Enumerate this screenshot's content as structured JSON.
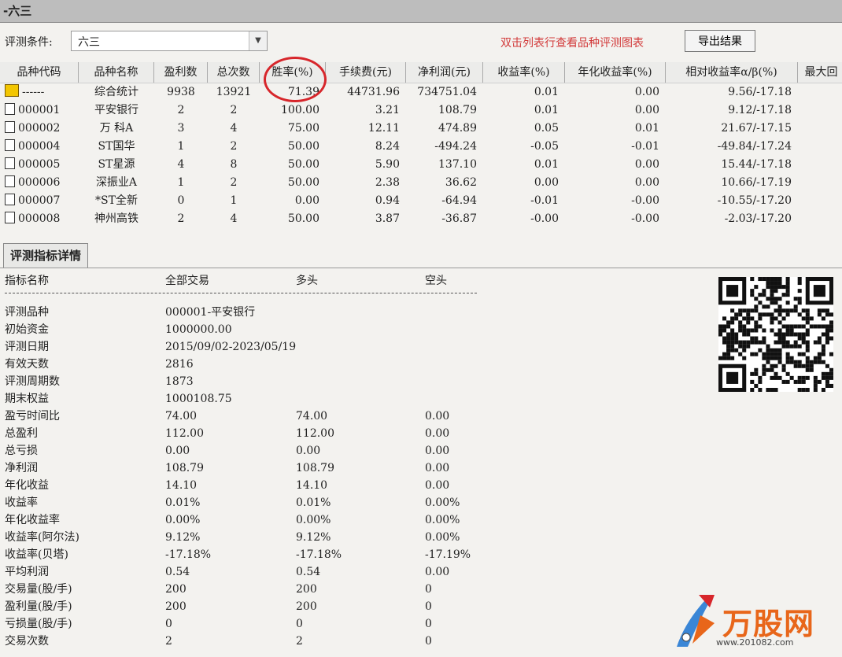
{
  "window": {
    "title": "-六三"
  },
  "condition": {
    "label": "评测条件:",
    "value": "六三",
    "hint": "双击列表行查看品种评测图表",
    "export_label": "导出结果"
  },
  "grid": {
    "columns": [
      "品种代码",
      "品种名称",
      "盈利数",
      "总次数",
      "胜率(%)",
      "手续费(元)",
      "净利润(元)",
      "收益率(%)",
      "年化收益率(%)",
      "相对收益率α/β(%)",
      "最大回"
    ],
    "rows": [
      {
        "code": "------",
        "name": "综合统计",
        "win": "9938",
        "total": "13921",
        "rate": "71.39",
        "fee": "44731.96",
        "profit": "734751.04",
        "ret": "0.01",
        "annual": "0.00",
        "rel": "9.56/-17.18"
      },
      {
        "code": "000001",
        "name": "平安银行",
        "win": "2",
        "total": "2",
        "rate": "100.00",
        "fee": "3.21",
        "profit": "108.79",
        "ret": "0.01",
        "annual": "0.00",
        "rel": "9.12/-17.18"
      },
      {
        "code": "000002",
        "name": "万 科A",
        "win": "3",
        "total": "4",
        "rate": "75.00",
        "fee": "12.11",
        "profit": "474.89",
        "ret": "0.05",
        "annual": "0.01",
        "rel": "21.67/-17.15"
      },
      {
        "code": "000004",
        "name": "ST国华",
        "win": "1",
        "total": "2",
        "rate": "50.00",
        "fee": "8.24",
        "profit": "-494.24",
        "ret": "-0.05",
        "annual": "-0.01",
        "rel": "-49.84/-17.24"
      },
      {
        "code": "000005",
        "name": "ST星源",
        "win": "4",
        "total": "8",
        "rate": "50.00",
        "fee": "5.90",
        "profit": "137.10",
        "ret": "0.01",
        "annual": "0.00",
        "rel": "15.44/-17.18"
      },
      {
        "code": "000006",
        "name": "深振业A",
        "win": "1",
        "total": "2",
        "rate": "50.00",
        "fee": "2.38",
        "profit": "36.62",
        "ret": "0.00",
        "annual": "0.00",
        "rel": "10.66/-17.19"
      },
      {
        "code": "000007",
        "name": "*ST全新",
        "win": "0",
        "total": "1",
        "rate": "0.00",
        "fee": "0.94",
        "profit": "-64.94",
        "ret": "-0.01",
        "annual": "-0.00",
        "rel": "-10.55/-17.20"
      },
      {
        "code": "000008",
        "name": "神州高铁",
        "win": "2",
        "total": "4",
        "rate": "50.00",
        "fee": "3.87",
        "profit": "-36.87",
        "ret": "-0.00",
        "annual": "-0.00",
        "rel": "-2.03/-17.20"
      }
    ]
  },
  "detail": {
    "tab_label": "评测指标详情",
    "headers": [
      "指标名称",
      "全部交易",
      "多头",
      "空头"
    ],
    "rows": [
      [
        "评测品种",
        "000001-平安银行",
        "",
        ""
      ],
      [
        "初始资金",
        "1000000.00",
        "",
        ""
      ],
      [
        "评测日期",
        "2015/09/02-2023/05/19",
        "",
        ""
      ],
      [
        "有效天数",
        "2816",
        "",
        ""
      ],
      [
        "评测周期数",
        "1873",
        "",
        ""
      ],
      [
        "期末权益",
        "1000108.75",
        "",
        ""
      ],
      [
        "盈亏时间比",
        "74.00",
        "74.00",
        "0.00"
      ],
      [
        "总盈利",
        "112.00",
        "112.00",
        "0.00"
      ],
      [
        "总亏损",
        "0.00",
        "0.00",
        "0.00"
      ],
      [
        "净利润",
        "108.79",
        "108.79",
        "0.00"
      ],
      [
        "年化收益",
        "14.10",
        "14.10",
        "0.00"
      ],
      [
        "收益率",
        "0.01%",
        "0.01%",
        "0.00%"
      ],
      [
        "年化收益率",
        "0.00%",
        "0.00%",
        "0.00%"
      ],
      [
        "收益率(阿尔法)",
        "9.12%",
        "9.12%",
        "0.00%"
      ],
      [
        "收益率(贝塔)",
        "-17.18%",
        "-17.18%",
        "-17.19%"
      ],
      [
        "平均利润",
        "0.54",
        "0.54",
        "0.00"
      ],
      [
        "交易量(股/手)",
        "200",
        "200",
        "0"
      ],
      [
        "盈利量(股/手)",
        "200",
        "200",
        "0"
      ],
      [
        "亏损量(股/手)",
        "0",
        "0",
        "0"
      ],
      [
        "交易次数",
        "2",
        "2",
        "0"
      ]
    ]
  },
  "logo": {
    "text": "万股网",
    "url": "www.201082.com"
  },
  "colors": {
    "hint": "#d23a3a",
    "circle": "#d7262b",
    "logo": "#e8661a"
  }
}
